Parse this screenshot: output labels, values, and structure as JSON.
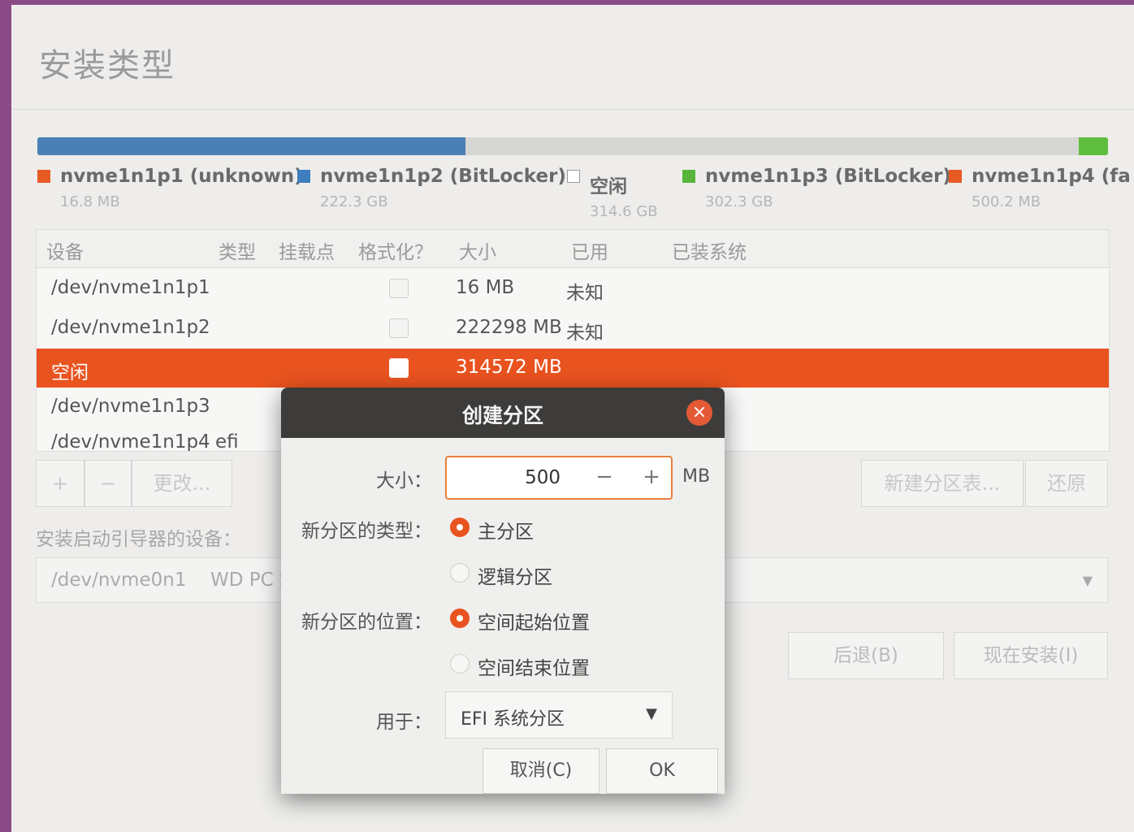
{
  "page": {
    "title": "安装类型"
  },
  "colors": {
    "accent": "#e9531f",
    "partition_blue": "#3d7ebf",
    "partition_green": "#58b43a",
    "partition_orange": "#e65a24"
  },
  "disk_bar": [
    {
      "color": "#4a7fb3",
      "fraction": 0.4
    },
    {
      "color": "#d6d6d4",
      "fraction": 0.573
    },
    {
      "color": "#5fbd3d",
      "fraction": 0.027
    }
  ],
  "legend": [
    {
      "name": "nvme1n1p1 (unknown)",
      "size": "16.8 MB",
      "color": "#e65a24"
    },
    {
      "name": "nvme1n1p2 (BitLocker)",
      "size": "222.3 GB",
      "color": "#3d7ebf"
    },
    {
      "name": "空闲",
      "size": "314.6 GB",
      "color": "none"
    },
    {
      "name": "nvme1n1p3 (BitLocker)",
      "size": "302.3 GB",
      "color": "#58b43a"
    },
    {
      "name": "nvme1n1p4 (fa",
      "size": "500.2 MB",
      "color": "#e65a24"
    }
  ],
  "table": {
    "headers": {
      "device": "设备",
      "type": "类型",
      "mount": "挂载点",
      "format": "格式化？",
      "size": "大小",
      "used": "已用",
      "system": "已装系统"
    },
    "rows": [
      {
        "device": "/dev/nvme1n1p1",
        "type": "",
        "size": "16 MB",
        "used": "未知"
      },
      {
        "device": "/dev/nvme1n1p2",
        "type": "",
        "size": "222298 MB",
        "used": "未知"
      },
      {
        "device": "空闲",
        "type": "",
        "size": "314572 MB",
        "used": ""
      },
      {
        "device": "/dev/nvme1n1p3",
        "type": "",
        "size": "",
        "used": ""
      },
      {
        "device": "/dev/nvme1n1p4",
        "type": "efi",
        "size": "",
        "used": ""
      }
    ]
  },
  "toolbar": {
    "add": "+",
    "remove": "−",
    "change": "更改...",
    "new_table": "新建分区表...",
    "revert": "还原"
  },
  "boot": {
    "label": "安装启动引导器的设备：",
    "device": "/dev/nvme0n1",
    "model": "WD PC S"
  },
  "nav": {
    "back": "后退(B)",
    "install": "现在安装(I)"
  },
  "dialog": {
    "title": "创建分区",
    "close": "×",
    "size_label": "大小：",
    "size_value": "500",
    "minus": "−",
    "plus": "+",
    "unit": "MB",
    "type_label": "新分区的类型：",
    "type_primary": "主分区",
    "type_logical": "逻辑分区",
    "location_label": "新分区的位置：",
    "location_start": "空间起始位置",
    "location_end": "空间结束位置",
    "use_label": "用于：",
    "use_value": "EFI 系统分区",
    "cancel": "取消(C)",
    "ok": "OK"
  }
}
